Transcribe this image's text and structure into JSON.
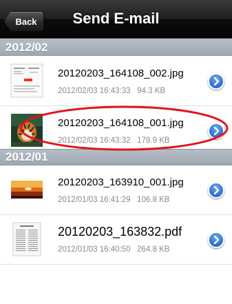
{
  "navbar": {
    "back_label": "Back",
    "title": "Send E-mail"
  },
  "sections": [
    {
      "header": "2012/02",
      "items": [
        {
          "filename": "20120203_164108_002.jpg",
          "date": "2012/02/03 16:43:33",
          "size": "94.3 KB",
          "thumb": "document-thumbnail"
        },
        {
          "filename": "20120203_164108_001.jpg",
          "date": "2012/02/03 16:43:32",
          "size": "179.9 KB",
          "thumb": "tiger-photo-thumbnail"
        }
      ]
    },
    {
      "header": "2012/01",
      "items": [
        {
          "filename": "20120203_163910_001.jpg",
          "date": "2012/01/03 16:41:29",
          "size": "106.8 KB",
          "thumb": "sunset-photo-thumbnail"
        },
        {
          "filename": "20120203_163832.pdf",
          "date": "2012/01/03 16:40:50",
          "size": "264.8 KB",
          "thumb": "pdf-page-thumbnail"
        }
      ]
    }
  ],
  "colors": {
    "annotation": "#e0141c",
    "disclosure": "#2a6dd3"
  }
}
